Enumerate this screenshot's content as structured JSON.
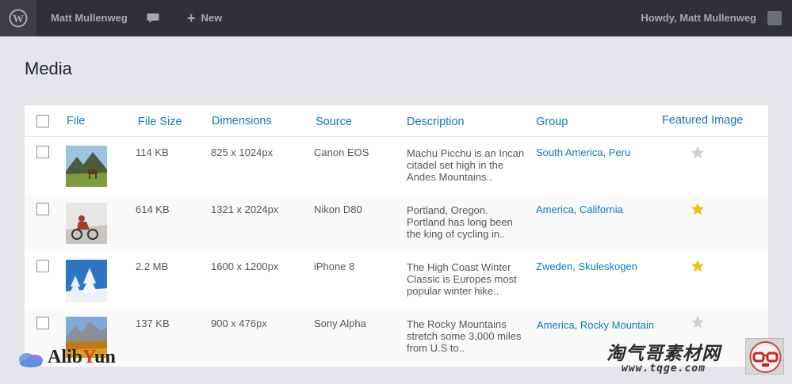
{
  "adminbar": {
    "user_name": "Matt Mullenweg",
    "new_label": "New",
    "howdy": "Howdy,  Matt Mullenweg",
    "icons": [
      "wordpress-logo-icon",
      "comment-icon",
      "plus-icon",
      "avatar"
    ]
  },
  "page": {
    "title": "Media"
  },
  "table": {
    "headers": {
      "file": "File",
      "file_size": "File Size",
      "dimensions": "Dimensions",
      "source": "Source",
      "description": "Description",
      "group": "Group",
      "featured": "Featured Image"
    },
    "rows": [
      {
        "size": "114 KB",
        "dimensions": "825 x 1024px",
        "source": "Canon EOS",
        "description": "Machu Picchu is an Incan citadel set high in the Andes Mountains..",
        "group": "South America, Peru",
        "featured": false,
        "thumb": "mountain-horse"
      },
      {
        "size": "614 KB",
        "dimensions": "1321 x 2024px",
        "source": "Nikon D80",
        "description": "Portland, Oregon. Portland has long been the king of cycling in..",
        "group": "America, California",
        "featured": true,
        "thumb": "cyclist"
      },
      {
        "size": "2.2 MB",
        "dimensions": "1600 x 1200px",
        "source": "iPhone 8",
        "description": "The High Coast Winter Classic is Europes most popular winter hike..",
        "group": "Zweden, Skuleskogen",
        "featured": true,
        "thumb": "snowy-trees"
      },
      {
        "size": "137 KB",
        "dimensions": "900 x 476px",
        "source": "Sony Alpha",
        "description": "The Rocky Mountains stretch some 3,000 miles from U.S to..",
        "group": "America, Rocky Mountain",
        "featured": false,
        "thumb": "autumn-mountains"
      }
    ]
  },
  "colors": {
    "accent": "#0f79b4",
    "star_on": "#e8c912",
    "star_off": "#d0d0d0",
    "adminbar": "#2f3134"
  },
  "watermarks": {
    "left_brand": "AlibYun",
    "right_cn": "淘气哥素材网",
    "right_url": "www.tqge.com"
  }
}
